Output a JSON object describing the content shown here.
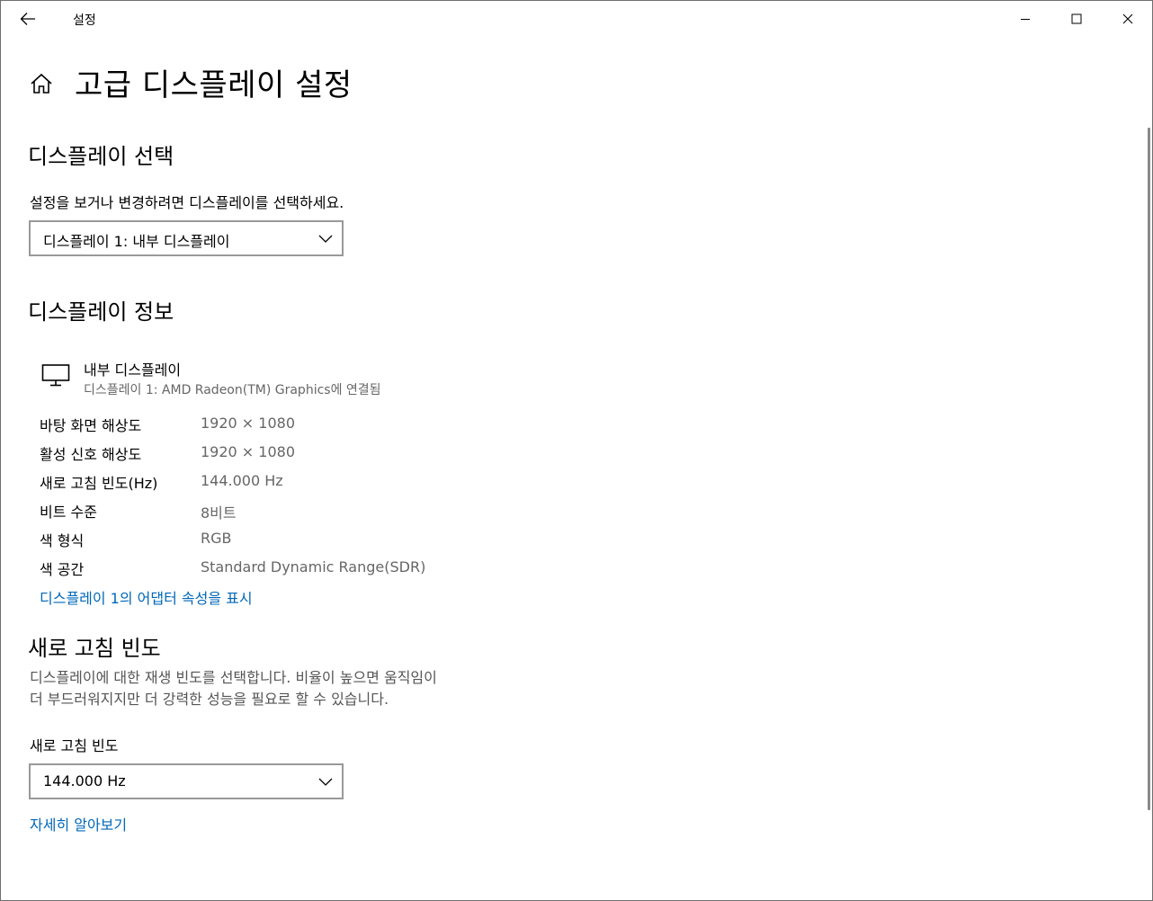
{
  "titlebar": {
    "app_title": "설정"
  },
  "page": {
    "title": "고급 디스플레이 설정"
  },
  "select_display": {
    "heading": "디스플레이 선택",
    "description": "설정을 보거나 변경하려면 디스플레이를 선택하세요.",
    "selected": "디스플레이 1: 내부 디스플레이"
  },
  "display_info": {
    "heading": "디스플레이 정보",
    "display_name": "내부 디스플레이",
    "display_sub": "디스플레이 1: AMD Radeon(TM) Graphics에 연결됨",
    "rows": [
      {
        "label": "바탕 화면 해상도",
        "value": "1920 × 1080"
      },
      {
        "label": "활성 신호 해상도",
        "value": "1920 × 1080"
      },
      {
        "label": "새로 고침 빈도(Hz)",
        "value": "144.000 Hz"
      },
      {
        "label": "비트 수준",
        "value": "8비트"
      },
      {
        "label": "색 형식",
        "value": "RGB"
      },
      {
        "label": "색 공간",
        "value": "Standard Dynamic Range(SDR)"
      }
    ],
    "adapter_link": "디스플레이 1의 어댑터 속성을 표시"
  },
  "refresh_rate": {
    "heading": "새로 고침 빈도",
    "description_line1": "디스플레이에 대한 재생 빈도를 선택합니다. 비율이 높으면 움직임이",
    "description_line2": "더 부드러워지지만 더 강력한 성능을 필요로 할 수 있습니다.",
    "field_label": "새로 고침 빈도",
    "selected": "144.000 Hz",
    "learn_more_link": "자세히 알아보기"
  },
  "icons": {
    "back": "back-arrow-icon",
    "home": "home-icon",
    "monitor": "monitor-icon",
    "minimize": "minimize-icon",
    "maximize": "maximize-icon",
    "close": "close-icon",
    "dropdown": "chevron-down-icon"
  },
  "colors": {
    "link": "#0067b8",
    "secondary_text": "#666666",
    "combo_border": "#999999"
  }
}
